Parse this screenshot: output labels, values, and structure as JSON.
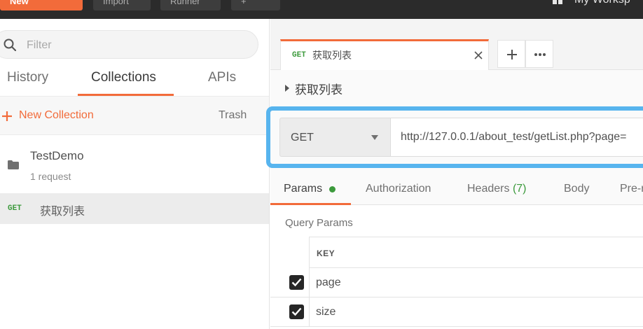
{
  "topbar": {
    "new_label": "New",
    "import_label": "Import",
    "runner_label": "Runner",
    "extra_label": "+",
    "workspace_label": "My Worksp"
  },
  "sidebar": {
    "filter_placeholder": "Filter",
    "tabs": [
      {
        "label": "History"
      },
      {
        "label": "Collections",
        "active": true
      },
      {
        "label": "APIs"
      }
    ],
    "new_collection_label": "New Collection",
    "trash_label": "Trash",
    "collection": {
      "name": "TestDemo",
      "count": "1 request"
    },
    "request": {
      "method": "GET",
      "name": "获取列表"
    }
  },
  "main": {
    "tab": {
      "method": "GET",
      "label": "获取列表"
    },
    "title": "获取列表",
    "method": "GET",
    "url": "http://127.0.0.1/about_test/getList.php?page=",
    "param_tabs": {
      "params": "Params",
      "authorization": "Authorization",
      "headers": "Headers",
      "headers_count": "(7)",
      "body": "Body",
      "pre": "Pre-r"
    },
    "query_params_label": "Query Params",
    "table": {
      "key_header": "KEY",
      "rows": [
        {
          "key": "page",
          "checked": true
        },
        {
          "key": "size",
          "checked": true
        }
      ]
    }
  },
  "colors": {
    "accent": "#f26b3a",
    "get_method": "#3c9a3c",
    "url_highlight": "#57b4ee"
  }
}
